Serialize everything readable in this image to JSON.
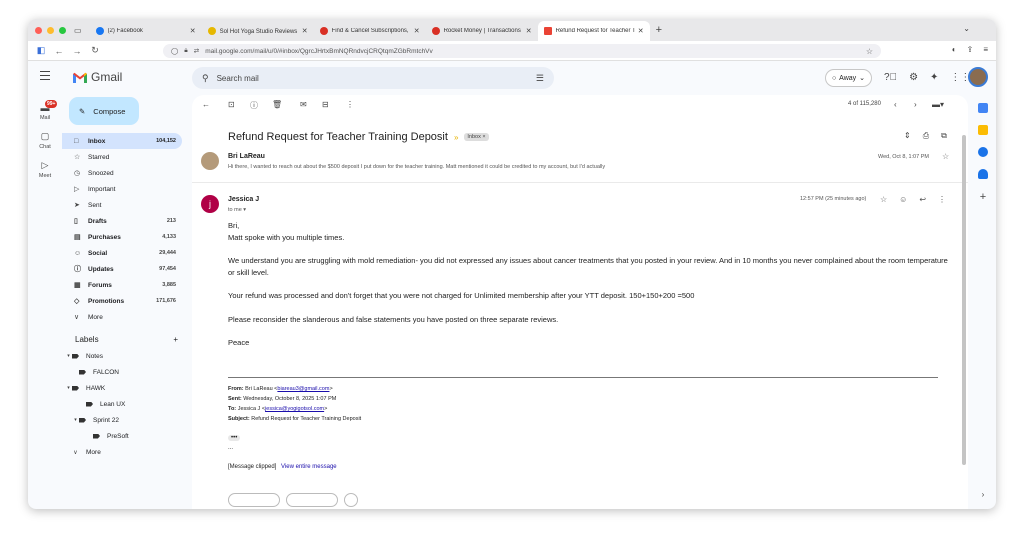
{
  "browser": {
    "tabs": [
      {
        "label": "(2) Facebook",
        "color": "#1877f2"
      },
      {
        "label": "Sol Hot Yoga Studio Reviews - ( ✕",
        "color": "#e6b800"
      },
      {
        "label": "Find & Cancel Subscriptions, Tr",
        "color": "#d93025"
      },
      {
        "label": "Rocket Money | Transactions",
        "color": "#d93025"
      },
      {
        "label": "Refund Request for Teacher Trai",
        "color": "#ea4335"
      }
    ],
    "url": "mail.google.com/mail/u/0/#inbox/QgrcJHrtxBmNQRndvcjCRQtqmZGbRmtchVv"
  },
  "gmail": {
    "logo_text": "Gmail",
    "search_placeholder": "Search mail",
    "status": "Away",
    "rail": [
      {
        "label": "Mail",
        "badge": "99+"
      },
      {
        "label": "Chat"
      },
      {
        "label": "Meet"
      }
    ],
    "compose_label": "Compose",
    "folders": [
      {
        "label": "Inbox",
        "count": "104,152",
        "icon": "□"
      },
      {
        "label": "Starred",
        "count": "",
        "icon": "☆"
      },
      {
        "label": "Snoozed",
        "count": "",
        "icon": "◷"
      },
      {
        "label": "Important",
        "count": "",
        "icon": "▷"
      },
      {
        "label": "Sent",
        "count": "",
        "icon": "➤"
      },
      {
        "label": "Drafts",
        "count": "213",
        "icon": "▯"
      },
      {
        "label": "Purchases",
        "count": "4,133",
        "icon": "▤"
      },
      {
        "label": "Social",
        "count": "29,444",
        "icon": "☺"
      },
      {
        "label": "Updates",
        "count": "97,454",
        "icon": "ⓘ"
      },
      {
        "label": "Forums",
        "count": "3,885",
        "icon": "▦"
      },
      {
        "label": "Promotions",
        "count": "171,676",
        "icon": "◇"
      },
      {
        "label": "More",
        "count": "",
        "icon": "∨"
      }
    ],
    "labels_title": "Labels",
    "labels": [
      {
        "label": "Notes",
        "indent": 0,
        "arrow": "▾"
      },
      {
        "label": "FALCON",
        "indent": 1,
        "arrow": ""
      },
      {
        "label": "HAWK",
        "indent": 0,
        "arrow": "▾"
      },
      {
        "label": "Lean UX",
        "indent": 2,
        "arrow": ""
      },
      {
        "label": "Sprint 22",
        "indent": 1,
        "arrow": "▾"
      },
      {
        "label": "PreSoft",
        "indent": 3,
        "arrow": ""
      },
      {
        "label": "More",
        "indent": 0,
        "arrow": "∨"
      }
    ],
    "pager": "4 of 115,280",
    "thread": {
      "subject": "Refund Request for Teacher Training Deposit",
      "chip": "Inbox ×",
      "messages": [
        {
          "sender": "Bri LaReau",
          "snippet": "Hi there, I wanted to reach out about the $500 deposit I put down for the teacher training. Matt mentioned it could be credited to my account, but I'd actually",
          "date": "Wed, Oct 8, 1:07 PM"
        },
        {
          "sender": "Jessica J",
          "avatar_letter": "j",
          "to": "to me ▾",
          "date": "12:57 PM (25 minutes ago)",
          "body": [
            "Bri,",
            "Matt spoke with you multiple times.",
            "",
            "We understand you are struggling with mold remediation- you did not expressed any issues about cancer treatments that you posted in your review.  And in 10 months you never complained about the room temperature or skill level.",
            "",
            "Your refund was processed and don't forget that you were not charged for Unlimited membership after your YTT deposit.  150+150+200 =500",
            "",
            "Please reconsider the slanderous and false statements you have posted on three separate reviews.",
            "",
            "Peace"
          ],
          "forward": {
            "from_label": "From:",
            "from_value": "Bri LaReau <",
            "from_email": "biareau3@gmail.com",
            "sent_label": "Sent:",
            "sent_value": "Wednesday, October 8, 2025 1:07 PM",
            "to_label": "To:",
            "to_value": "Jessica J <",
            "to_email": "jessica@yogigotsol.com",
            "subject_label": "Subject:",
            "subject_value": "Refund Request for Teacher Training Deposit"
          },
          "ellipsis": "•••",
          "dots": "...",
          "clipped_text": "[Message clipped]",
          "clipped_link": "View entire message"
        }
      ]
    }
  }
}
